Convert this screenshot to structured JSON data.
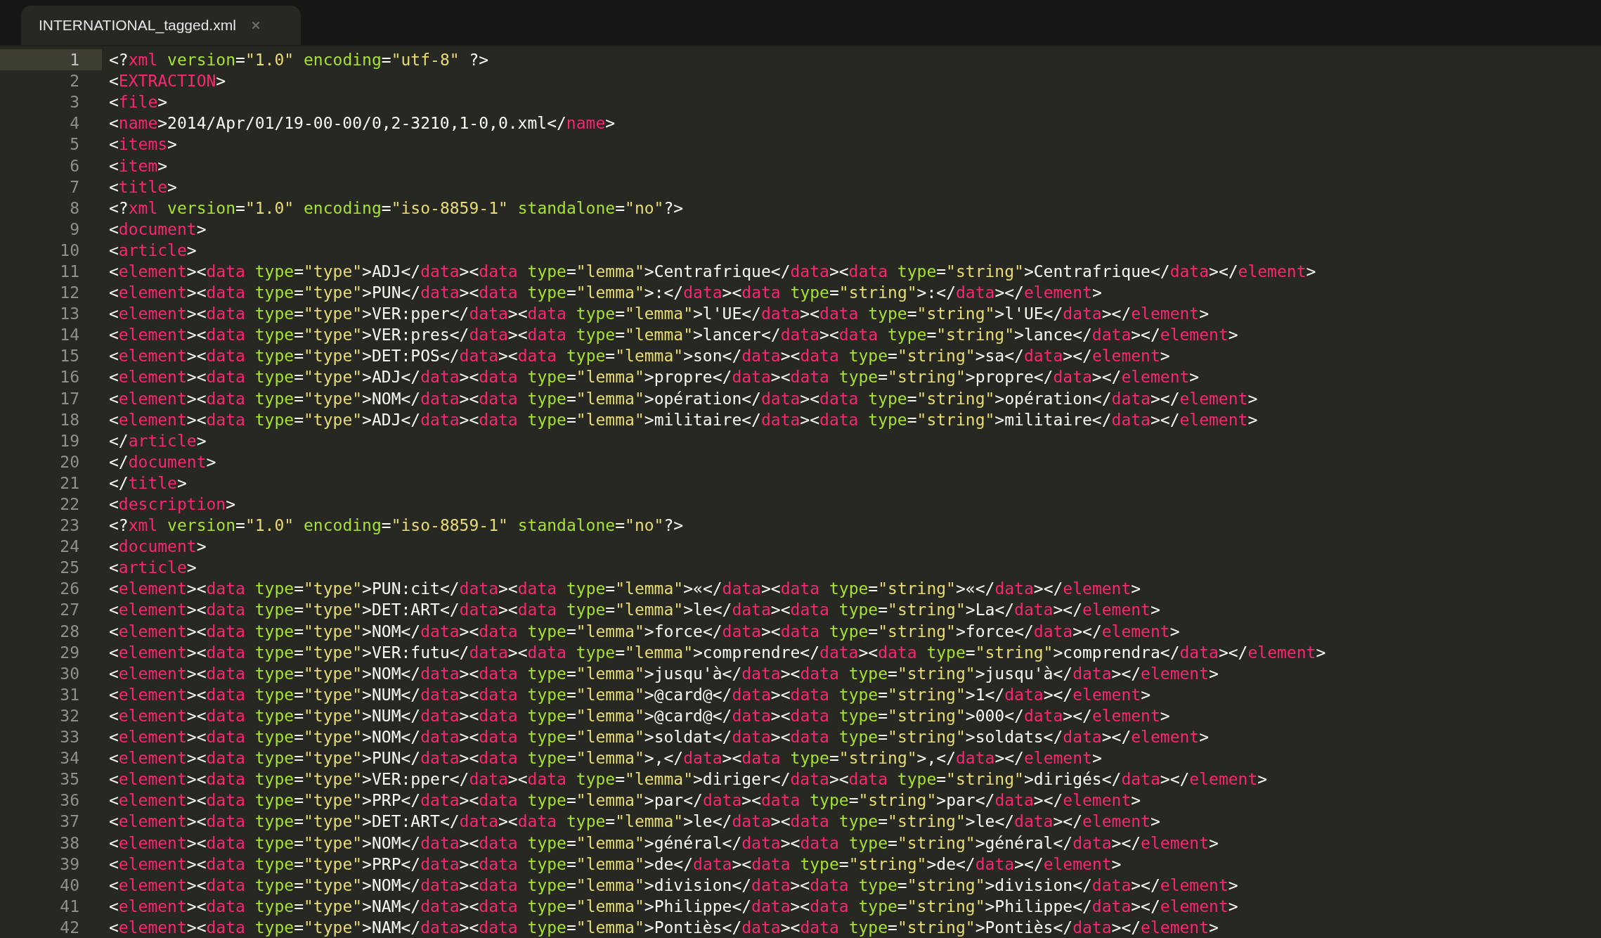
{
  "tab": {
    "title": "INTERNATIONAL_tagged.xml",
    "selected": true
  },
  "lines": [
    {
      "number": "1",
      "text": "<?xml version=\"1.0\" encoding=\"utf-8\" ?>",
      "current": true
    },
    {
      "number": "2",
      "text": "<EXTRACTION>",
      "current": false
    },
    {
      "number": "3",
      "text": "<file>",
      "current": false
    },
    {
      "number": "4",
      "text": "<name>2014/Apr/01/19-00-00/0,2-3210,1-0,0.xml</name>",
      "current": false
    },
    {
      "number": "5",
      "text": "<items>",
      "current": false
    },
    {
      "number": "6",
      "text": "<item>",
      "current": false
    },
    {
      "number": "7",
      "text": "<title>",
      "current": false
    },
    {
      "number": "8",
      "text": "<?xml version=\"1.0\" encoding=\"iso-8859-1\" standalone=\"no\"?>",
      "current": false
    },
    {
      "number": "9",
      "text": "<document>",
      "current": false
    },
    {
      "number": "10",
      "text": "<article>",
      "current": false
    },
    {
      "number": "11",
      "text": "<element><data type=\"type\">ADJ</data><data type=\"lemma\">Centrafrique</data><data type=\"string\">Centrafrique</data></element>",
      "current": false
    },
    {
      "number": "12",
      "text": "<element><data type=\"type\">PUN</data><data type=\"lemma\">:</data><data type=\"string\">:</data></element>",
      "current": false
    },
    {
      "number": "13",
      "text": "<element><data type=\"type\">VER:pper</data><data type=\"lemma\">l'UE</data><data type=\"string\">l'UE</data></element>",
      "current": false
    },
    {
      "number": "14",
      "text": "<element><data type=\"type\">VER:pres</data><data type=\"lemma\">lancer</data><data type=\"string\">lance</data></element>",
      "current": false
    },
    {
      "number": "15",
      "text": "<element><data type=\"type\">DET:POS</data><data type=\"lemma\">son</data><data type=\"string\">sa</data></element>",
      "current": false
    },
    {
      "number": "16",
      "text": "<element><data type=\"type\">ADJ</data><data type=\"lemma\">propre</data><data type=\"string\">propre</data></element>",
      "current": false
    },
    {
      "number": "17",
      "text": "<element><data type=\"type\">NOM</data><data type=\"lemma\">opération</data><data type=\"string\">opération</data></element>",
      "current": false
    },
    {
      "number": "18",
      "text": "<element><data type=\"type\">ADJ</data><data type=\"lemma\">militaire</data><data type=\"string\">militaire</data></element>",
      "current": false
    },
    {
      "number": "19",
      "text": "</article>",
      "current": false
    },
    {
      "number": "20",
      "text": "</document>",
      "current": false
    },
    {
      "number": "21",
      "text": "</title>",
      "current": false
    },
    {
      "number": "22",
      "text": "<description>",
      "current": false
    },
    {
      "number": "23",
      "text": "<?xml version=\"1.0\" encoding=\"iso-8859-1\" standalone=\"no\"?>",
      "current": false
    },
    {
      "number": "24",
      "text": "<document>",
      "current": false
    },
    {
      "number": "25",
      "text": "<article>",
      "current": false
    },
    {
      "number": "26",
      "text": "<element><data type=\"type\">PUN:cit</data><data type=\"lemma\">«</data><data type=\"string\">«</data></element>",
      "current": false
    },
    {
      "number": "27",
      "text": "<element><data type=\"type\">DET:ART</data><data type=\"lemma\">le</data><data type=\"string\">La</data></element>",
      "current": false
    },
    {
      "number": "28",
      "text": "<element><data type=\"type\">NOM</data><data type=\"lemma\">force</data><data type=\"string\">force</data></element>",
      "current": false
    },
    {
      "number": "29",
      "text": "<element><data type=\"type\">VER:futu</data><data type=\"lemma\">comprendre</data><data type=\"string\">comprendra</data></element>",
      "current": false
    },
    {
      "number": "30",
      "text": "<element><data type=\"type\">NOM</data><data type=\"lemma\">jusqu'à</data><data type=\"string\">jusqu'à</data></element>",
      "current": false
    },
    {
      "number": "31",
      "text": "<element><data type=\"type\">NUM</data><data type=\"lemma\">@card@</data><data type=\"string\">1</data></element>",
      "current": false
    },
    {
      "number": "32",
      "text": "<element><data type=\"type\">NUM</data><data type=\"lemma\">@card@</data><data type=\"string\">000</data></element>",
      "current": false
    },
    {
      "number": "33",
      "text": "<element><data type=\"type\">NOM</data><data type=\"lemma\">soldat</data><data type=\"string\">soldats</data></element>",
      "current": false
    },
    {
      "number": "34",
      "text": "<element><data type=\"type\">PUN</data><data type=\"lemma\">,</data><data type=\"string\">,</data></element>",
      "current": false
    },
    {
      "number": "35",
      "text": "<element><data type=\"type\">VER:pper</data><data type=\"lemma\">diriger</data><data type=\"string\">dirigés</data></element>",
      "current": false
    },
    {
      "number": "36",
      "text": "<element><data type=\"type\">PRP</data><data type=\"lemma\">par</data><data type=\"string\">par</data></element>",
      "current": false
    },
    {
      "number": "37",
      "text": "<element><data type=\"type\">DET:ART</data><data type=\"lemma\">le</data><data type=\"string\">le</data></element>",
      "current": false
    },
    {
      "number": "38",
      "text": "<element><data type=\"type\">NOM</data><data type=\"lemma\">général</data><data type=\"string\">général</data></element>",
      "current": false
    },
    {
      "number": "39",
      "text": "<element><data type=\"type\">PRP</data><data type=\"lemma\">de</data><data type=\"string\">de</data></element>",
      "current": false
    },
    {
      "number": "40",
      "text": "<element><data type=\"type\">NOM</data><data type=\"lemma\">division</data><data type=\"string\">division</data></element>",
      "current": false
    },
    {
      "number": "41",
      "text": "<element><data type=\"type\">NAM</data><data type=\"lemma\">Philippe</data><data type=\"string\">Philippe</data></element>",
      "current": false
    },
    {
      "number": "42",
      "text": "<element><data type=\"type\">NAM</data><data type=\"lemma\">Pontiès</data><data type=\"string\">Pontiès</data></element>",
      "current": false
    }
  ]
}
